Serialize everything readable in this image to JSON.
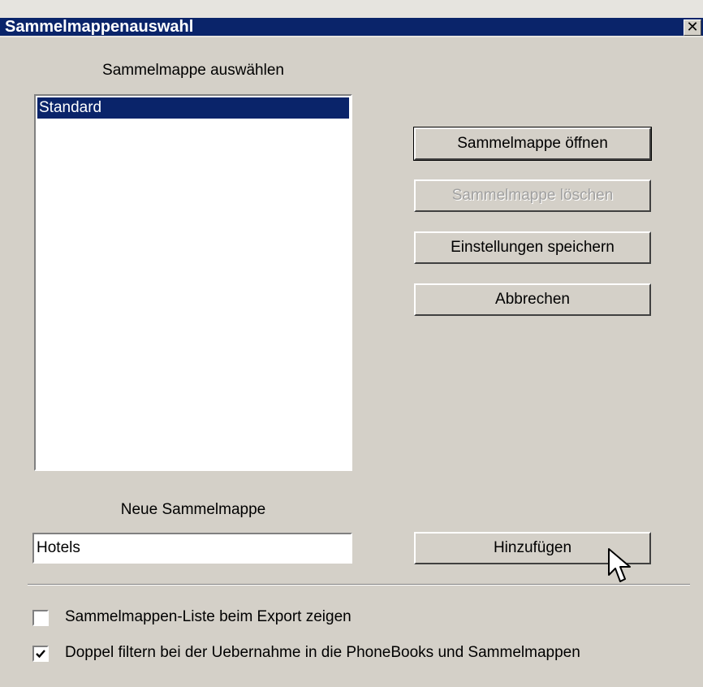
{
  "window": {
    "title": "Sammelmappenauswahl",
    "close_glyph": "✕"
  },
  "list_section": {
    "label": "Sammelmappe auswählen",
    "items": [
      "Standard"
    ]
  },
  "buttons": {
    "open": "Sammelmappe öffnen",
    "delete": "Sammelmappe löschen",
    "save": "Einstellungen speichern",
    "cancel": "Abbrechen",
    "add": "Hinzufügen"
  },
  "new_section": {
    "label": "Neue Sammelmappe",
    "value": "Hotels"
  },
  "options": {
    "show_list": {
      "label": "Sammelmappen-Liste beim Export zeigen",
      "checked": false
    },
    "filter_duplicates": {
      "label": "Doppel filtern bei der Uebernahme in die PhoneBooks und Sammelmappen",
      "checked": true
    }
  },
  "colors": {
    "selection": "#0a246a",
    "dialog": "#d4d0c8"
  },
  "icons": {
    "close": "close-icon",
    "check": "check-icon",
    "cursor": "mouse-cursor-icon"
  }
}
